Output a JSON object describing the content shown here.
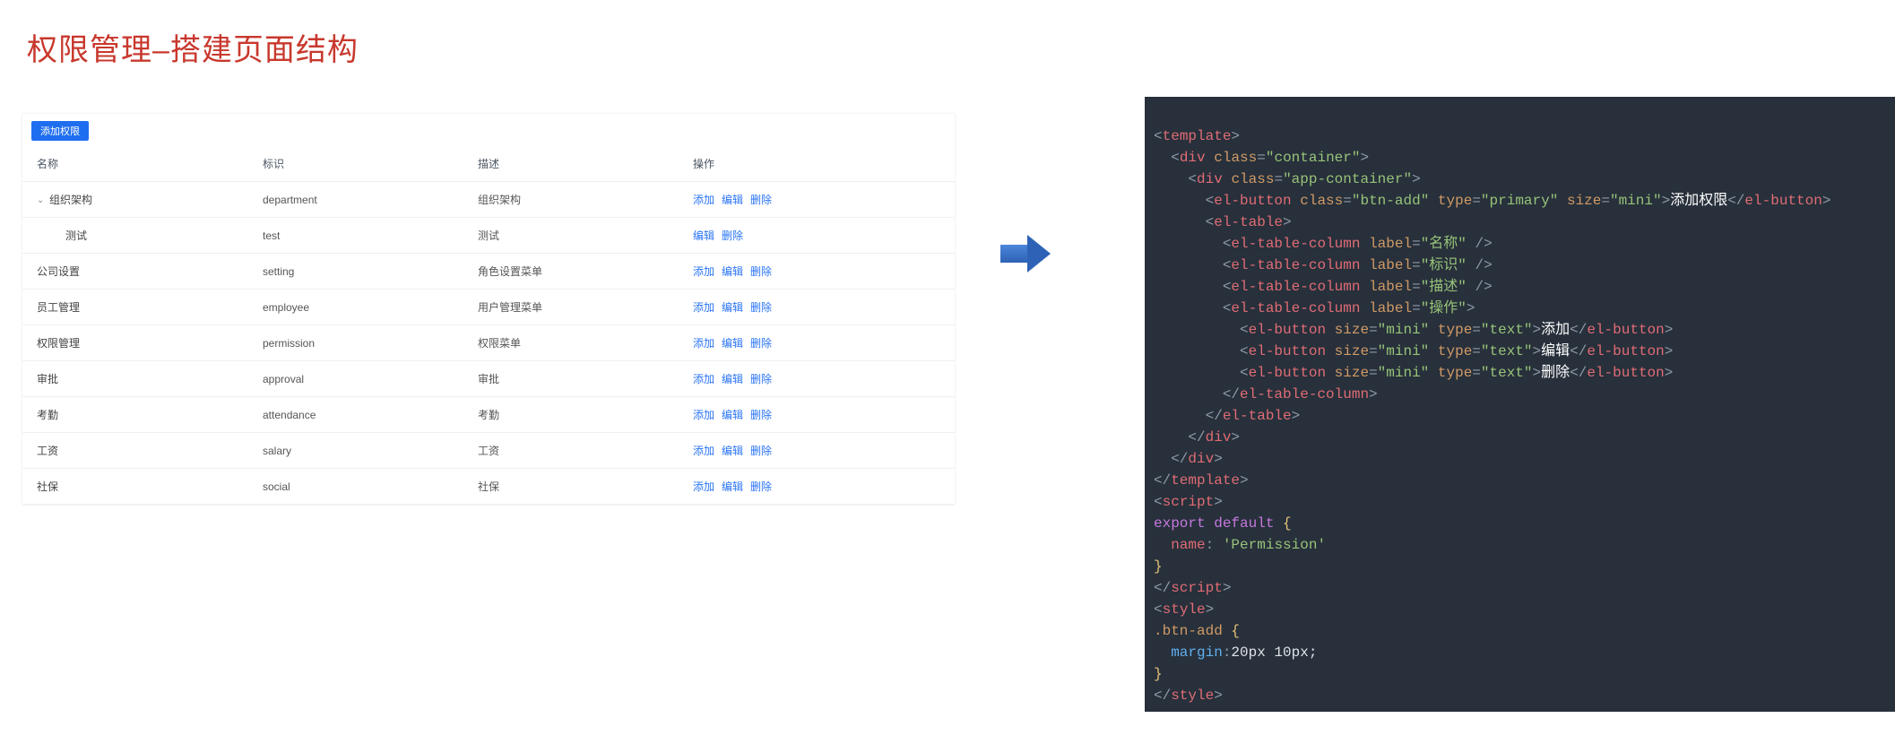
{
  "heading": "权限管理–搭建页面结构",
  "toolbar": {
    "add_label": "添加权限"
  },
  "table": {
    "columns": {
      "name": "名称",
      "identifier": "标识",
      "desc": "描述",
      "op": "操作"
    },
    "ops": {
      "add": "添加",
      "edit": "编辑",
      "del": "删除"
    },
    "rows": [
      {
        "name": "组织架构",
        "identifier": "department",
        "desc": "组织架构",
        "indent": 0,
        "expanded": true,
        "ops": [
          "add",
          "edit",
          "del"
        ]
      },
      {
        "name": "测试",
        "identifier": "test",
        "desc": "测试",
        "indent": 1,
        "ops": [
          "edit",
          "del"
        ]
      },
      {
        "name": "公司设置",
        "identifier": "setting",
        "desc": "角色设置菜单",
        "indent": 0,
        "ops": [
          "add",
          "edit",
          "del"
        ]
      },
      {
        "name": "员工管理",
        "identifier": "employee",
        "desc": "用户管理菜单",
        "indent": 0,
        "ops": [
          "add",
          "edit",
          "del"
        ]
      },
      {
        "name": "权限管理",
        "identifier": "permission",
        "desc": "权限菜单",
        "indent": 0,
        "ops": [
          "add",
          "edit",
          "del"
        ]
      },
      {
        "name": "审批",
        "identifier": "approval",
        "desc": "审批",
        "indent": 0,
        "ops": [
          "add",
          "edit",
          "del"
        ]
      },
      {
        "name": "考勤",
        "identifier": "attendance",
        "desc": "考勤",
        "indent": 0,
        "ops": [
          "add",
          "edit",
          "del"
        ]
      },
      {
        "name": "工资",
        "identifier": "salary",
        "desc": "工资",
        "indent": 0,
        "ops": [
          "add",
          "edit",
          "del"
        ]
      },
      {
        "name": "社保",
        "identifier": "social",
        "desc": "社保",
        "indent": 0,
        "ops": [
          "add",
          "edit",
          "del"
        ]
      }
    ]
  },
  "code": {
    "t_template_open": "template",
    "t_div": "div",
    "t_el_button": "el-button",
    "t_el_table": "el-table",
    "t_el_table_column": "el-table-column",
    "t_script": "script",
    "t_style": "style",
    "a_class": "class",
    "a_type": "type",
    "a_size": "size",
    "a_label": "label",
    "v_container": "\"container\"",
    "v_app_container": "\"app-container\"",
    "v_btn_add": "\"btn-add\"",
    "v_primary": "\"primary\"",
    "v_mini": "\"mini\"",
    "v_text": "\"text\"",
    "v_label_name": "\"名称\"",
    "v_label_id": "\"标识\"",
    "v_label_desc": "\"描述\"",
    "v_label_op": "\"操作\"",
    "txt_add_perm": "添加权限",
    "txt_add": "添加",
    "txt_edit": "编辑",
    "txt_del": "删除",
    "kw_export": "export",
    "kw_default": "default",
    "prop_name": "name",
    "str_permission": "'Permission'",
    "css_selector": ".btn-add",
    "css_margin_prop": "margin",
    "css_margin_val": "20px 10px;"
  }
}
